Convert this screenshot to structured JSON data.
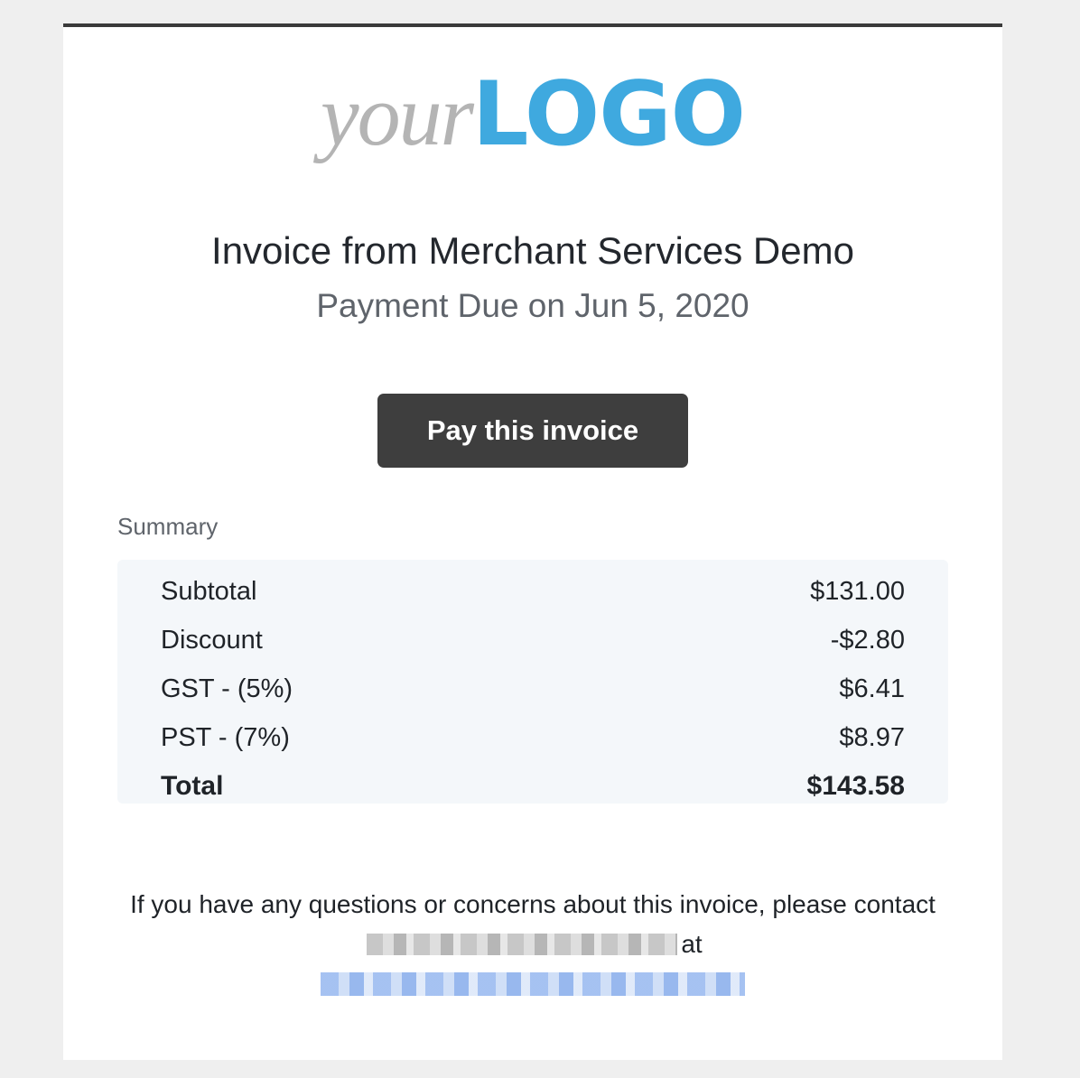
{
  "logo": {
    "part_one": "your",
    "part_two": "LOGO"
  },
  "invoice": {
    "title": "Invoice from Merchant Services Demo",
    "due": "Payment Due on Jun 5, 2020",
    "pay_label": "Pay this invoice"
  },
  "summary": {
    "heading": "Summary",
    "rows": [
      {
        "label": "Subtotal",
        "value": "$131.00"
      },
      {
        "label": "Discount",
        "value": "-$2.80"
      },
      {
        "label": "GST - (5%)",
        "value": "$6.41"
      },
      {
        "label": "PST - (7%)",
        "value": "$8.97"
      },
      {
        "label": "Total",
        "value": "$143.58"
      }
    ]
  },
  "footer": {
    "line_start": "If you have any questions or concerns about this invoice, please contact",
    "line_mid": "at"
  },
  "colors": {
    "brand_blue": "#3fa9df",
    "button_dark": "#3e3e3e"
  }
}
